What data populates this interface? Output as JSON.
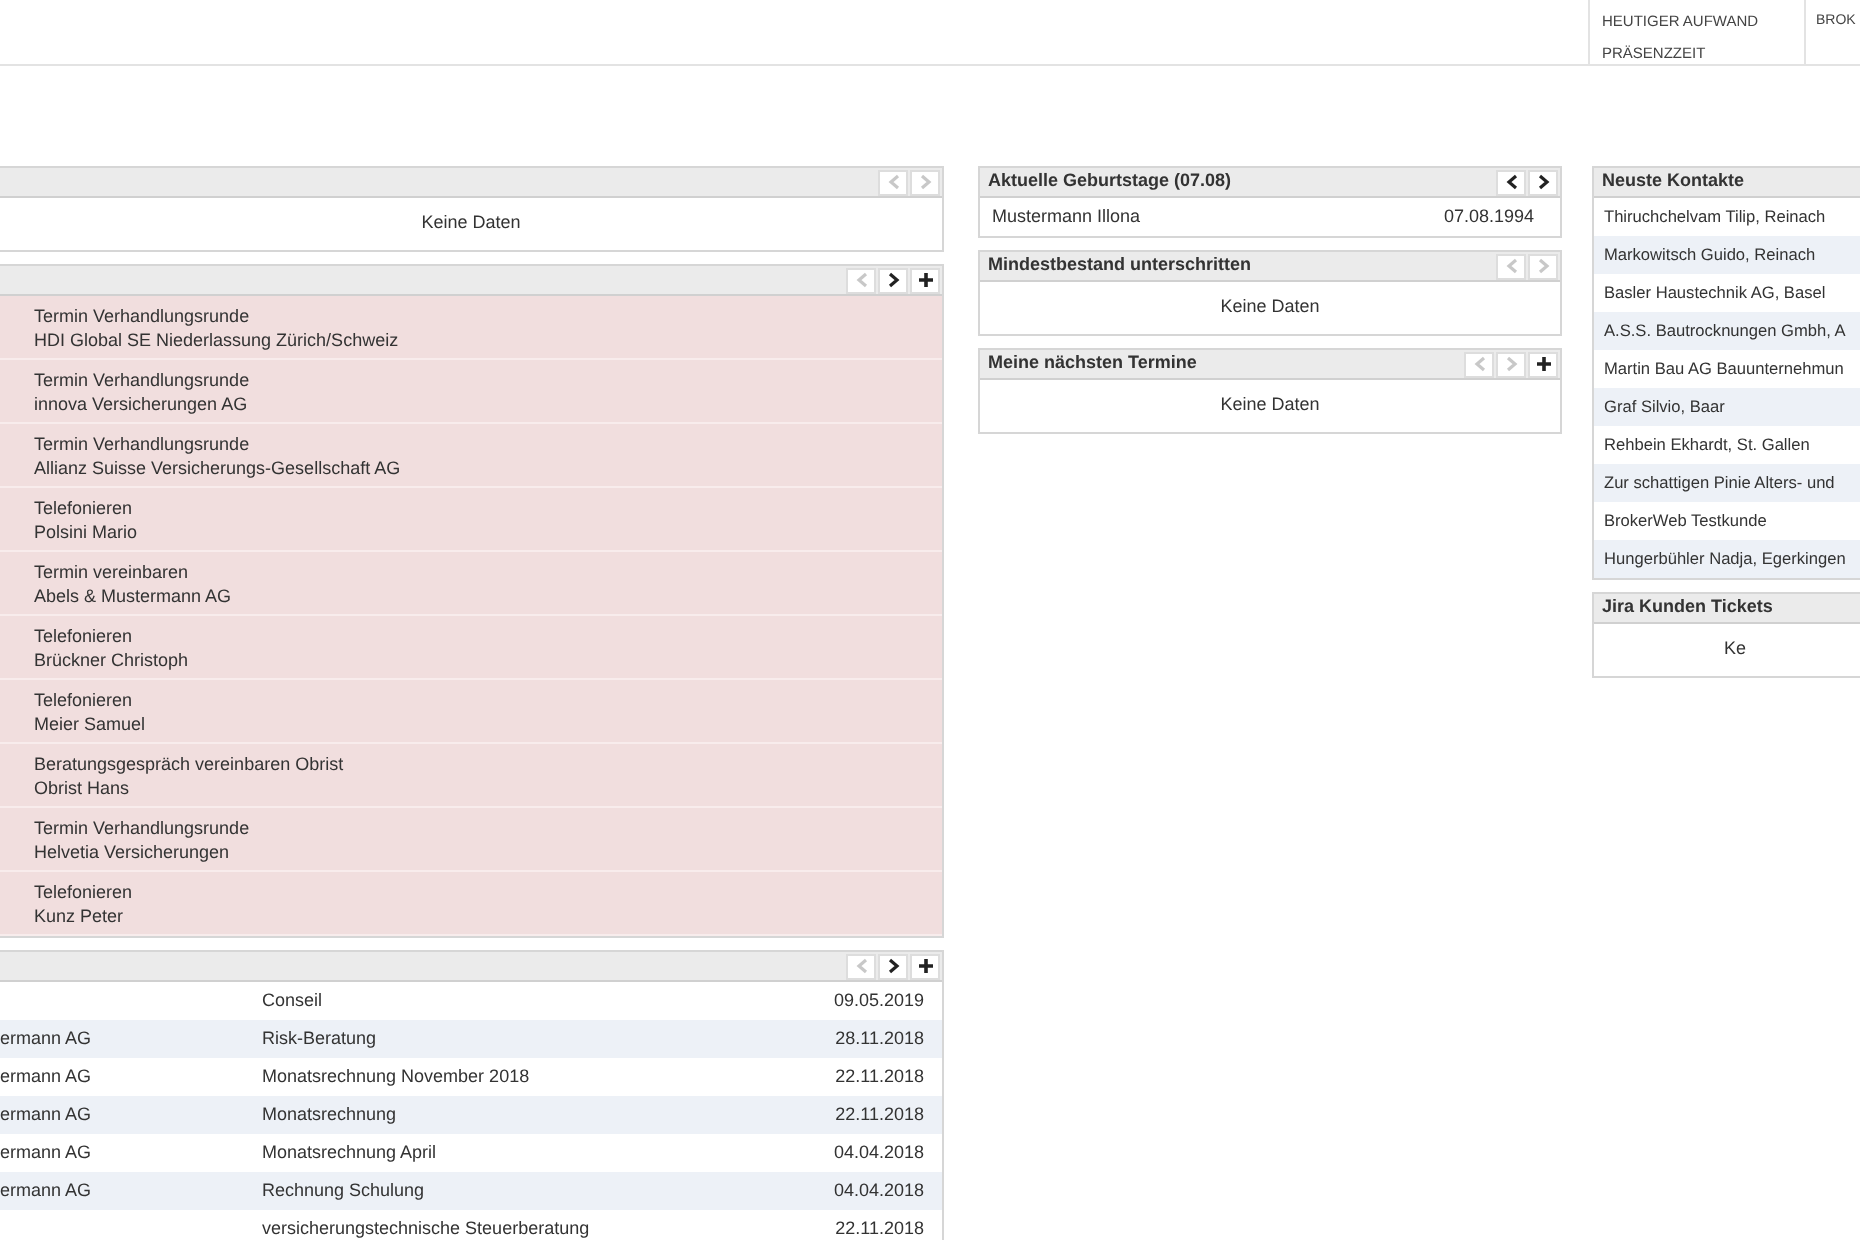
{
  "header": {
    "stats_labels": [
      "HEUTIGER AUFWAND",
      "PRÄSENZZEIT"
    ],
    "column_2": "BROK"
  },
  "columns": [
    {
      "widgets": [
        {
          "kind": "empty",
          "buttons": [
            {
              "kind": "prev",
              "disabled": true
            },
            {
              "kind": "next",
              "disabled": true
            }
          ],
          "message": "Keine Daten"
        },
        {
          "kind": "tasks",
          "buttons": [
            {
              "kind": "prev",
              "disabled": true
            },
            {
              "kind": "next",
              "disabled": false
            },
            {
              "kind": "add",
              "disabled": false
            }
          ],
          "items": [
            {
              "title": "Termin Verhandlungsrunde",
              "subtitle": "HDI Global SE Niederlassung Zürich/Schweiz",
              "overdue": true
            },
            {
              "title": "Termin Verhandlungsrunde",
              "subtitle": "innova Versicherungen AG",
              "overdue": true
            },
            {
              "title": "Termin Verhandlungsrunde",
              "subtitle": "Allianz Suisse Versicherungs-Gesellschaft AG",
              "overdue": true
            },
            {
              "title": "Telefonieren",
              "subtitle": "Polsini Mario",
              "overdue": true
            },
            {
              "title": "Termin vereinbaren",
              "subtitle": "Abels & Mustermann AG",
              "overdue": true
            },
            {
              "title": "Telefonieren",
              "subtitle": "Brückner Christoph",
              "overdue": true
            },
            {
              "title": "Telefonieren",
              "subtitle": "Meier Samuel",
              "overdue": true
            },
            {
              "title": "Beratungsgespräch vereinbaren Obrist",
              "subtitle": "Obrist Hans",
              "overdue": true
            },
            {
              "title": "Termin Verhandlungsrunde",
              "subtitle": "Helvetia Versicherungen",
              "overdue": true
            },
            {
              "title": "Telefonieren",
              "subtitle": "Kunz Peter",
              "overdue": true
            }
          ]
        },
        {
          "kind": "table",
          "buttons": [
            {
              "kind": "prev",
              "disabled": true
            },
            {
              "kind": "next",
              "disabled": false
            },
            {
              "kind": "add",
              "disabled": false
            }
          ],
          "rows": [
            [
              "",
              "Conseil",
              "09.05.2019"
            ],
            [
              "ermann AG",
              "Risk-Beratung",
              "28.11.2018"
            ],
            [
              "ermann AG",
              "Monatsrechnung November 2018",
              "22.11.2018"
            ],
            [
              "ermann AG",
              "Monatsrechnung",
              "22.11.2018"
            ],
            [
              "ermann AG",
              "Monatsrechnung April",
              "04.04.2018"
            ],
            [
              "ermann AG",
              "Rechnung Schulung",
              "04.04.2018"
            ],
            [
              "",
              "versicherungstechnische Steuerberatung",
              "22.11.2018"
            ]
          ]
        }
      ]
    },
    {
      "widgets": [
        {
          "kind": "pairs",
          "title": "Aktuelle Geburtstage (07.08)",
          "buttons": [
            {
              "kind": "prev",
              "disabled": false
            },
            {
              "kind": "next",
              "disabled": false
            }
          ],
          "rows": [
            [
              "Mustermann Illona",
              "07.08.1994"
            ]
          ]
        },
        {
          "kind": "empty",
          "title": "Mindestbestand unterschritten",
          "buttons": [
            {
              "kind": "prev",
              "disabled": true
            },
            {
              "kind": "next",
              "disabled": true
            }
          ],
          "message": "Keine Daten"
        },
        {
          "kind": "empty",
          "title": "Meine nächsten Termine",
          "buttons": [
            {
              "kind": "prev",
              "disabled": true
            },
            {
              "kind": "next",
              "disabled": true
            },
            {
              "kind": "add",
              "disabled": false
            }
          ],
          "message": "Keine Daten"
        }
      ]
    },
    {
      "widgets": [
        {
          "kind": "list",
          "title": "Neuste Kontakte",
          "items": [
            "Thiruchchelvam Tilip, Reinach",
            "Markowitsch Guido, Reinach",
            "Basler Haustechnik AG, Basel",
            "A.S.S. Bautrocknungen Gmbh, A",
            "Martin Bau AG Bauunternehmun",
            "Graf Silvio, Baar",
            "Rehbein Ekhardt, St. Gallen",
            "Zur schattigen Pinie Alters- und",
            "BrokerWeb Testkunde",
            "Hungerbühler Nadja, Egerkingen"
          ]
        },
        {
          "kind": "empty",
          "title": "Jira Kunden Tickets",
          "message": "Ke"
        }
      ]
    }
  ]
}
